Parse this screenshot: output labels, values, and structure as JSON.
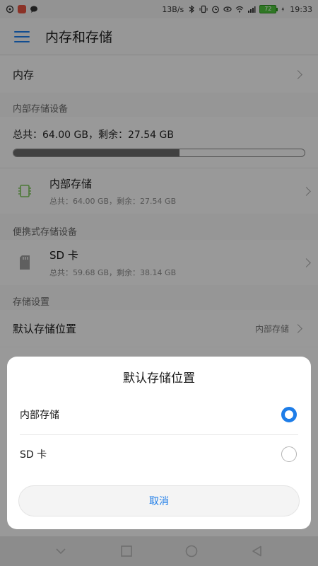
{
  "status_bar": {
    "speed": "13B/s",
    "battery": "72",
    "time": "19:33"
  },
  "header": {
    "title": "内存和存储"
  },
  "memory_row": {
    "label": "内存"
  },
  "internal_section": {
    "label": "内部存储设备",
    "summary": "总共：64.00 GB，剩余：27.54 GB",
    "used_fraction": 0.57,
    "device": {
      "title": "内部存储",
      "subtitle": "总共：64.00 GB，剩余：27.54 GB"
    }
  },
  "portable_section": {
    "label": "便携式存储设备",
    "device": {
      "title": "SD 卡",
      "subtitle": "总共：59.68 GB，剩余：38.14 GB"
    }
  },
  "storage_settings": {
    "label": "存储设置",
    "default_location": {
      "label": "默认存储位置",
      "value": "内部存储"
    }
  },
  "dialog": {
    "title": "默认存储位置",
    "options": [
      {
        "label": "内部存储",
        "selected": true
      },
      {
        "label": "SD 卡",
        "selected": false
      }
    ],
    "cancel_label": "取消"
  },
  "colors": {
    "accent": "#1e7de8",
    "chip_icon": "#7cc35a"
  }
}
